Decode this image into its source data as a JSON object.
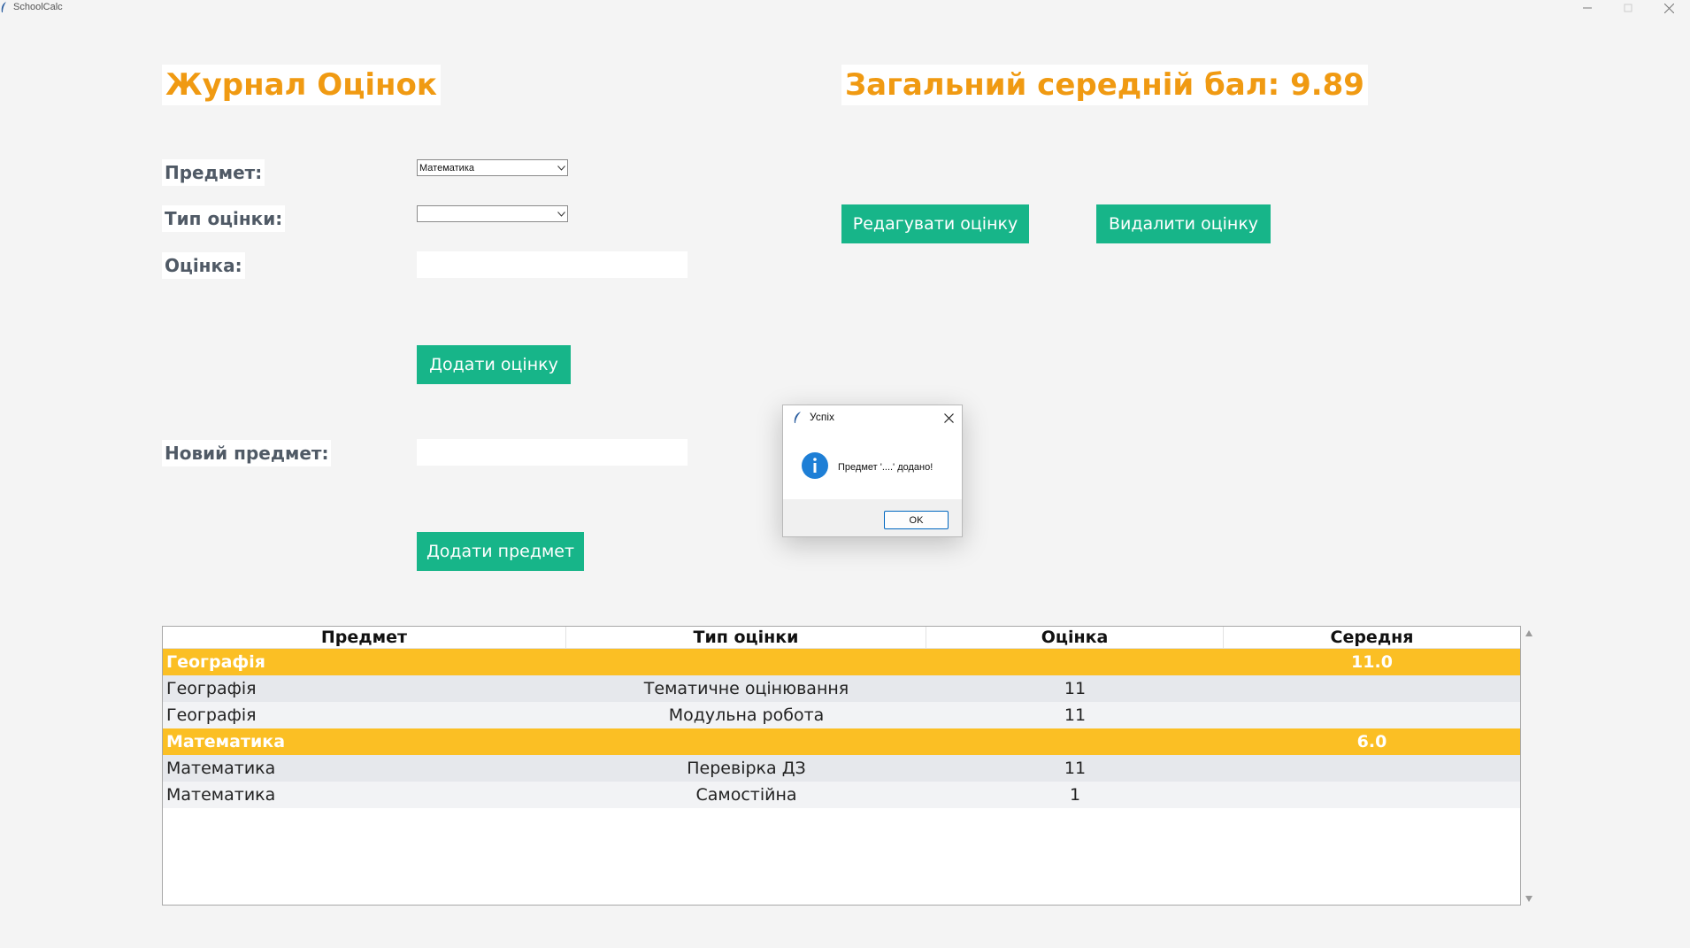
{
  "window": {
    "title": "SchoolCalc"
  },
  "header": {
    "title": "Журнал Оцінок",
    "average_label": "Загальний середній бал: 9.89"
  },
  "form": {
    "subject_label": "Предмет:",
    "subject_value": "Математика",
    "grade_type_label": "Тип оцінки:",
    "grade_type_value": "",
    "grade_label": "Оцінка:",
    "grade_value": "",
    "add_grade_button": "Додати оцінку",
    "new_subject_label": "Новий предмет:",
    "new_subject_value": "",
    "add_subject_button": "Додати предмет",
    "edit_button": "Редагувати оцінку",
    "delete_button": "Видалити оцінку"
  },
  "table": {
    "columns": [
      "Предмет",
      "Тип оцінки",
      "Оцінка",
      "Середня"
    ],
    "rows": [
      {
        "kind": "group",
        "subject": "Географія",
        "type": "",
        "grade": "",
        "average": "11.0"
      },
      {
        "kind": "item",
        "subject": "Географія",
        "type": "Тематичне оцінювання",
        "grade": "11",
        "average": ""
      },
      {
        "kind": "item",
        "subject": "Географія",
        "type": "Модульна робота",
        "grade": "11",
        "average": ""
      },
      {
        "kind": "group",
        "subject": "Математика",
        "type": "",
        "grade": "",
        "average": "6.0"
      },
      {
        "kind": "item",
        "subject": "Математика",
        "type": "Перевірка ДЗ",
        "grade": "11",
        "average": ""
      },
      {
        "kind": "item",
        "subject": "Математика",
        "type": "Самостійна",
        "grade": "1",
        "average": ""
      }
    ]
  },
  "dialog": {
    "title": "Успіх",
    "message": "Предмет '....' додано!",
    "ok_button": "OK",
    "icon": "info-icon"
  },
  "colors": {
    "heading": "#f09a12",
    "button": "#17b589",
    "group_row": "#fbbf24",
    "label_text": "#505a66"
  }
}
